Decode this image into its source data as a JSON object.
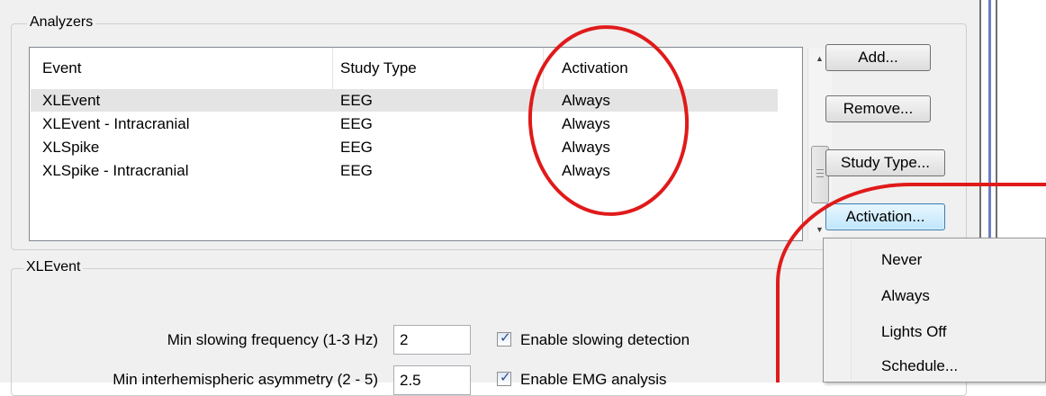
{
  "analyzers": {
    "group_label": "Analyzers",
    "columns": [
      "Event",
      "Study Type",
      "Activation"
    ],
    "rows": [
      {
        "event": "XLEvent",
        "study_type": "EEG",
        "activation": "Always"
      },
      {
        "event": "XLEvent - Intracranial",
        "study_type": "EEG",
        "activation": "Always"
      },
      {
        "event": "XLSpike",
        "study_type": "EEG",
        "activation": "Always"
      },
      {
        "event": "XLSpike - Intracranial",
        "study_type": "EEG",
        "activation": "Always"
      }
    ],
    "buttons": {
      "add": "Add...",
      "remove": "Remove...",
      "study_type": "Study Type...",
      "activation": "Activation..."
    }
  },
  "activation_menu": {
    "items": [
      "Never",
      "Always",
      "Lights Off",
      "Schedule..."
    ]
  },
  "xlevent": {
    "group_label": "XLEvent",
    "fields": [
      {
        "label": "Min slowing frequency (1-3 Hz)",
        "value": "2",
        "checkbox_label": "Enable slowing detection",
        "checked": true
      },
      {
        "label": "Min interhemispheric asymmetry (2 - 5)",
        "value": "2.5",
        "checkbox_label": "Enable EMG analysis",
        "checked": true
      }
    ]
  },
  "colors": {
    "annotation": "#e01a1a",
    "window_bg": "#f0f0f0",
    "selection_bg": "#e4e4e4",
    "active_button": "#bee6fd"
  },
  "icons": [
    "scroll-up-arrow-icon",
    "scroll-down-arrow-icon",
    "scroll-grip-icon",
    "checkmark-icon"
  ]
}
